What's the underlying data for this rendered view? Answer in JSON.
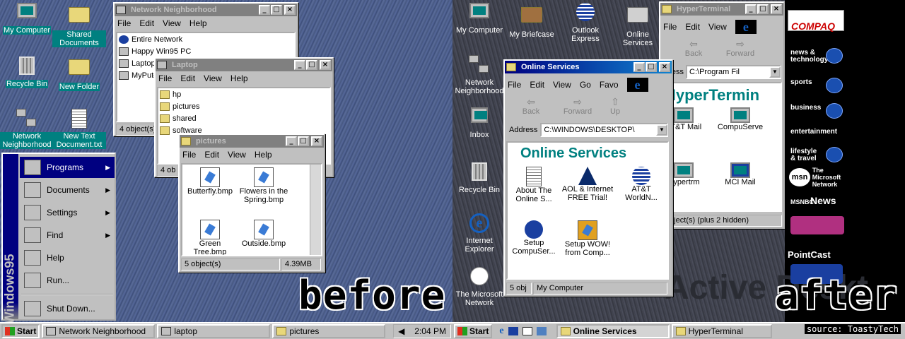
{
  "captions": {
    "before": "before",
    "after": "after",
    "source": "source: ToastyTech"
  },
  "left": {
    "icons": [
      {
        "label": "My Computer"
      },
      {
        "label": "Shared Documents"
      },
      {
        "label": "Recycle Bin"
      },
      {
        "label": "New Folder"
      },
      {
        "label": "Network Neighborhood"
      },
      {
        "label": "New Text Document.txt"
      }
    ],
    "netwin": {
      "title": "Network Neighborhood",
      "menu": [
        "File",
        "Edit",
        "View",
        "Help"
      ],
      "items": [
        "Entire Network",
        "Happy Win95 PC",
        "Laptop",
        "MyPute"
      ],
      "status": "4 object(s)"
    },
    "laptopwin": {
      "title": "Laptop",
      "menu": [
        "File",
        "Edit",
        "View",
        "Help"
      ],
      "items": [
        "hp",
        "pictures",
        "shared",
        "software"
      ],
      "status": "4 ob"
    },
    "picwin": {
      "title": "pictures",
      "menu": [
        "File",
        "Edit",
        "View",
        "Help"
      ],
      "files": [
        "Butterfly.bmp",
        "Flowers in the Spring.bmp",
        "Green Tree.bmp",
        "Outside.bmp"
      ],
      "status": "5 object(s)",
      "size": "4.39MB"
    },
    "startmenu": {
      "brand": "Windows95",
      "items": [
        {
          "label": "Programs",
          "arrow": "▶"
        },
        {
          "label": "Documents",
          "arrow": "▶"
        },
        {
          "label": "Settings",
          "arrow": "▶"
        },
        {
          "label": "Find",
          "arrow": "▶"
        },
        {
          "label": "Help",
          "arrow": ""
        },
        {
          "label": "Run...",
          "arrow": ""
        },
        {
          "label": "Shut Down...",
          "arrow": ""
        }
      ]
    },
    "taskbar": {
      "start": "Start",
      "buttons": [
        "Network Neighborhood",
        "laptop",
        "pictures"
      ],
      "clock": "2:04 PM"
    }
  },
  "right": {
    "icons": [
      {
        "label": "My Computer"
      },
      {
        "label": "My Briefcase"
      },
      {
        "label": "Outlook Express"
      },
      {
        "label": "Online Services"
      },
      {
        "label": "Network Neighborhood"
      },
      {
        "label": "Inbox"
      },
      {
        "label": "Recycle Bin"
      },
      {
        "label": "Internet Explorer"
      },
      {
        "label": "The Microsoft Network"
      }
    ],
    "onlinewin": {
      "title": "Online Services",
      "menu": [
        "File",
        "Edit",
        "View",
        "Go",
        "Favo"
      ],
      "tools": [
        "Back",
        "Forward",
        "Up"
      ],
      "address_label": "Address",
      "address": "C:\\WINDOWS\\DESKTOP\\",
      "heading": "Online Services",
      "items": [
        "About The Online S...",
        "AOL & Internet FREE Trial!",
        "AT&T WorldN...",
        "Setup CompuSer...",
        "Setup WOW! from Comp..."
      ],
      "status": "5 obj",
      "status2": "My Computer"
    },
    "hyperwin": {
      "title": "HyperTerminal",
      "menu": [
        "File",
        "Edit",
        "View"
      ],
      "tools": [
        "Back",
        "Forward"
      ],
      "address_label": "ddress",
      "address": "C:\\Program Fil",
      "heading": "HyperTermin",
      "items": [
        "AT&T Mail",
        "CompuServe",
        "Hypertrm",
        "MCI Mail"
      ],
      "status": "object(s) (plus 2 hidden)"
    },
    "wallpaper_text": "Active Deskt",
    "channels": {
      "compaq": "COMPAQ",
      "items": [
        "news & technology",
        "sports",
        "business",
        "entertainment",
        "lifestyle & travel"
      ],
      "msn": "The Microsoft Network",
      "msnbc": "News",
      "pointcast": "PointCast"
    },
    "taskbar": {
      "start": "Start",
      "buttons": [
        "Online Services",
        "HyperTerminal"
      ]
    }
  }
}
